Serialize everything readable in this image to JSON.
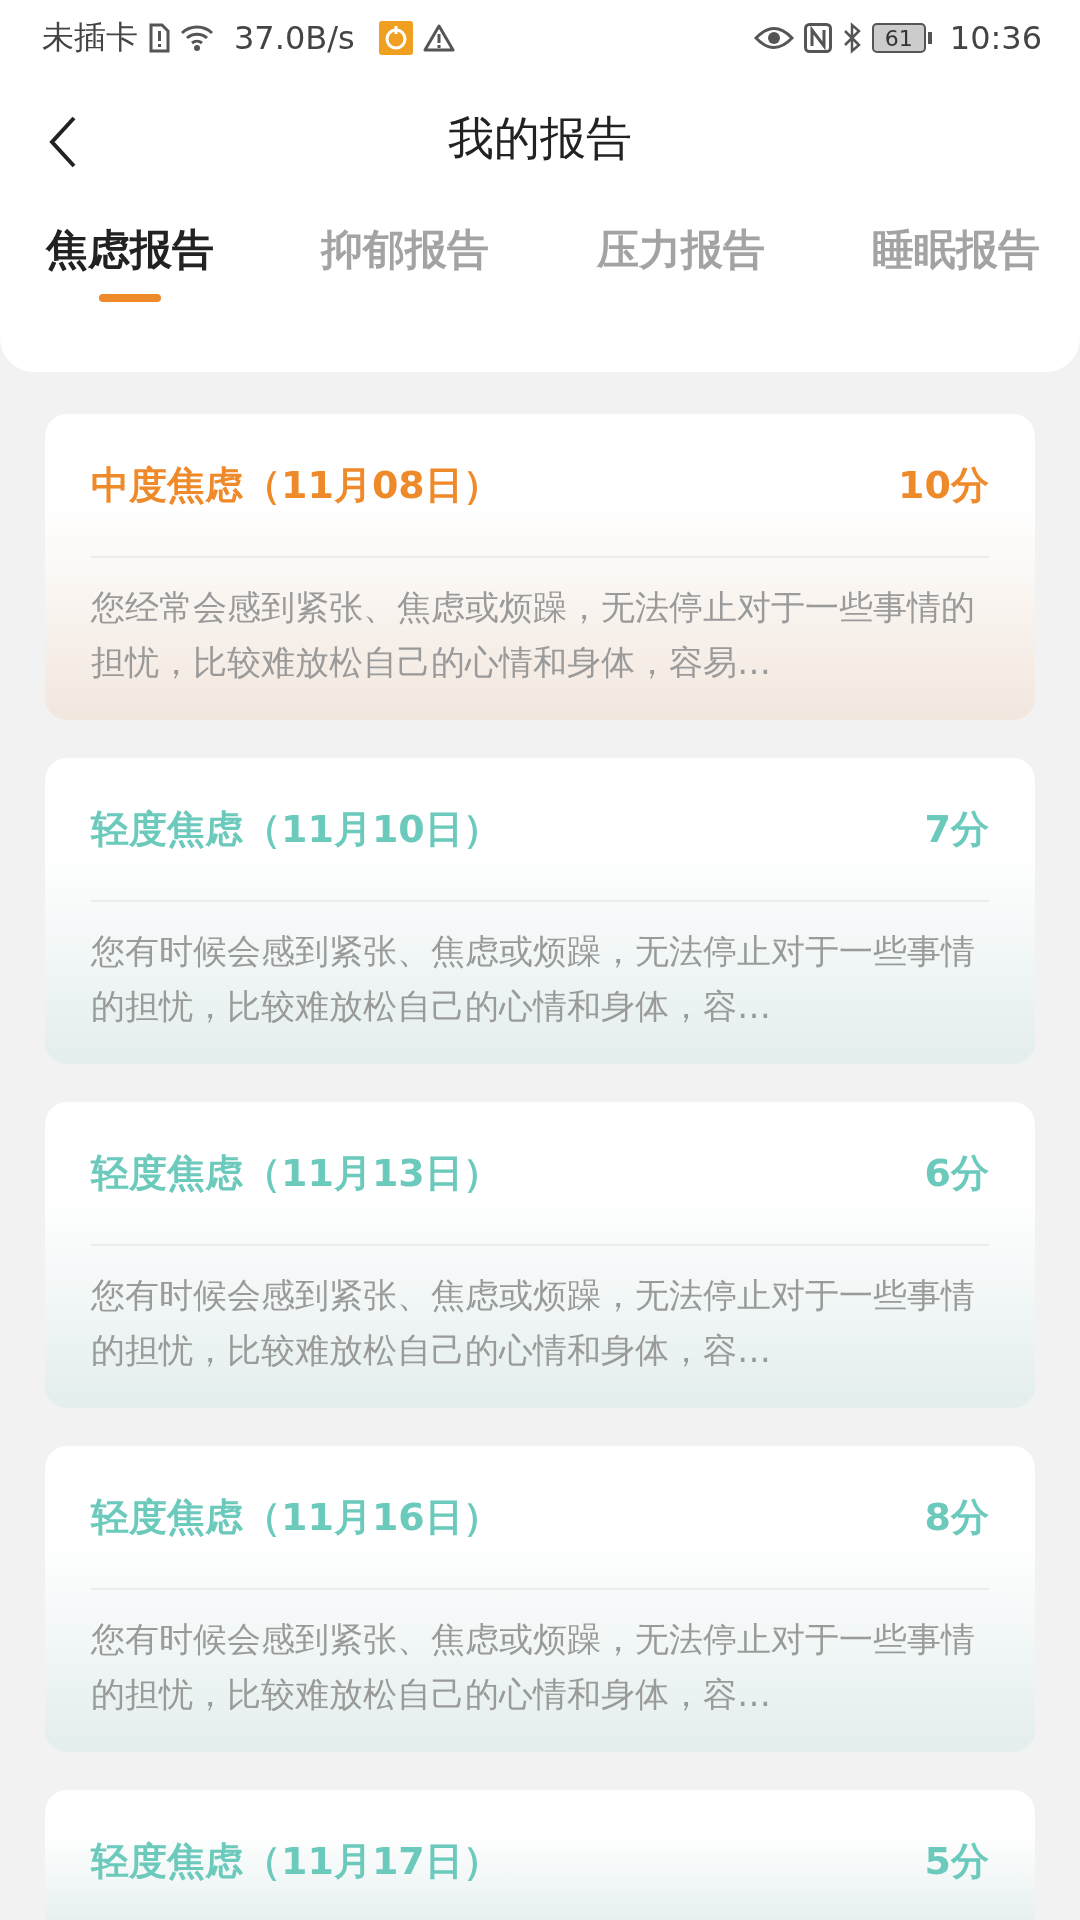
{
  "status_bar": {
    "carrier": "未插卡",
    "speed": "37.0B/s",
    "battery": "61",
    "time": "10:36"
  },
  "header": {
    "title": "我的报告"
  },
  "tabs": [
    {
      "label": "焦虑报告",
      "selected": true
    },
    {
      "label": "抑郁报告",
      "selected": false
    },
    {
      "label": "压力报告",
      "selected": false
    },
    {
      "label": "睡眠报告",
      "selected": false
    }
  ],
  "reports": [
    {
      "title": "中度焦虑（11月08日）",
      "score": "10分",
      "color": "#ef8a2b",
      "description": "您经常会感到紧张、焦虑或烦躁，无法停止对于一些事情的担忧，比较难放松自己的心情和身体，容易…"
    },
    {
      "title": "轻度焦虑（11月10日）",
      "score": "7分",
      "color": "#6ccabc",
      "description": "您有时候会感到紧张、焦虑或烦躁，无法停止对于一些事情的担忧，比较难放松自己的心情和身体，容…"
    },
    {
      "title": "轻度焦虑（11月13日）",
      "score": "6分",
      "color": "#6ccabc",
      "description": "您有时候会感到紧张、焦虑或烦躁，无法停止对于一些事情的担忧，比较难放松自己的心情和身体，容…"
    },
    {
      "title": "轻度焦虑（11月16日）",
      "score": "8分",
      "color": "#6ccabc",
      "description": "您有时候会感到紧张、焦虑或烦躁，无法停止对于一些事情的担忧，比较难放松自己的心情和身体，容…"
    },
    {
      "title": "轻度焦虑（11月17日）",
      "score": "5分",
      "color": "#6ccabc"
    }
  ]
}
